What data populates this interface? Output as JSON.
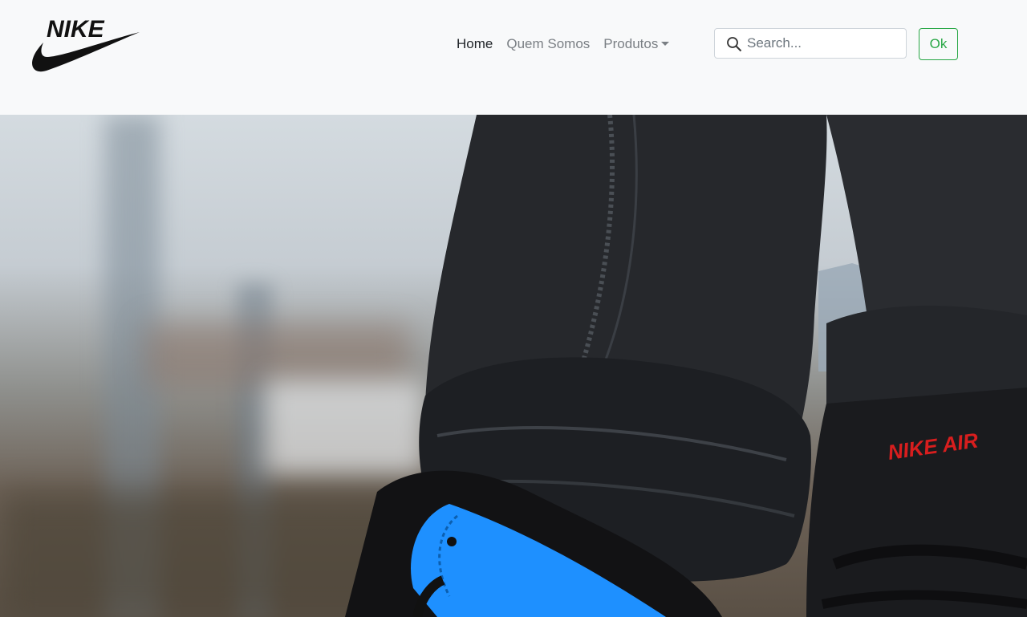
{
  "brand": {
    "logo_text": "NIKE",
    "icon": "nike-swoosh-logo"
  },
  "nav": {
    "items": [
      {
        "label": "Home",
        "active": true
      },
      {
        "label": "Quem Somos",
        "active": false
      },
      {
        "label": "Produtos",
        "active": false,
        "dropdown": true
      }
    ]
  },
  "search": {
    "placeholder": "Search...",
    "value": "",
    "icon": "search-icon"
  },
  "ok_button": {
    "label": "Ok"
  },
  "hero": {
    "icon": "hero-photo",
    "shoe_logo_text": "NIKE AIR"
  },
  "colors": {
    "navbar_bg": "#f8f9fa",
    "nav_active": "#212529",
    "nav_muted": "#7a7f84",
    "ok_green": "#28a745",
    "sneaker_blue": "#1e90ff",
    "air_red": "#d81e1e"
  }
}
